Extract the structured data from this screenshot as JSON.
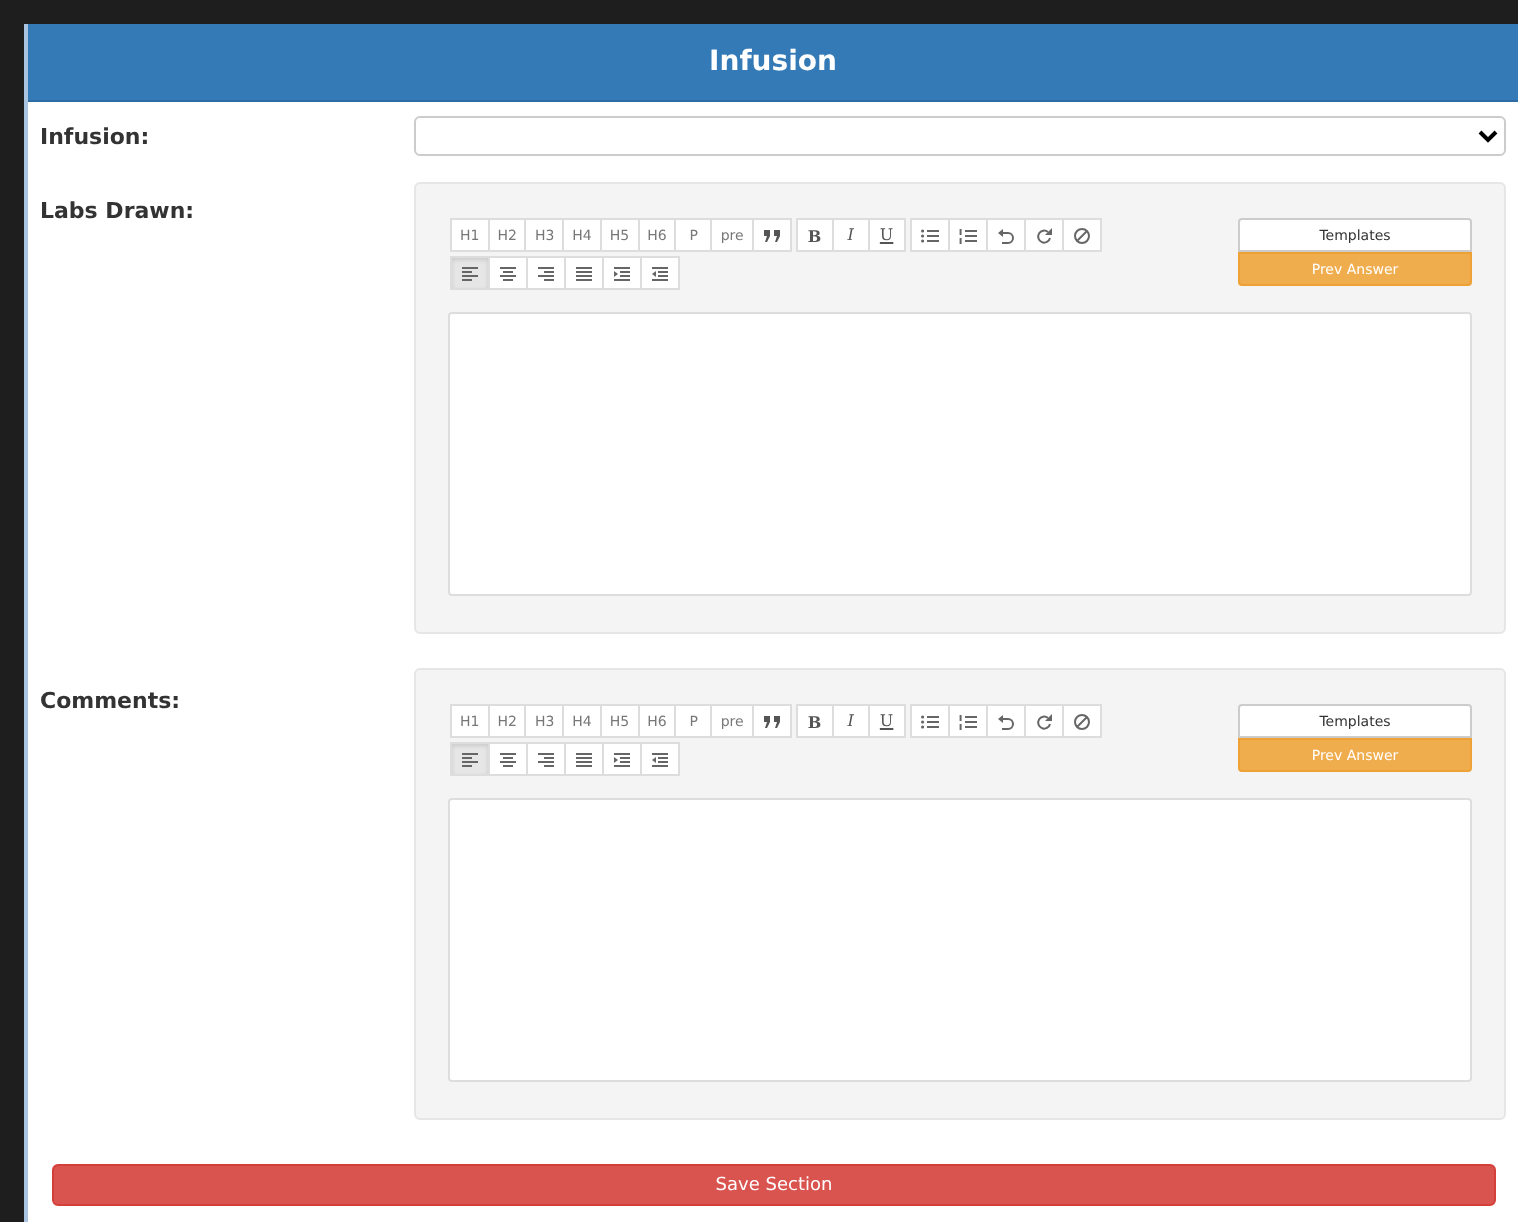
{
  "header": {
    "title": "Infusion"
  },
  "infusion": {
    "label": "Infusion:"
  },
  "editors": [
    {
      "label": "Labs Drawn:",
      "headings": [
        "H1",
        "H2",
        "H3",
        "H4",
        "H5",
        "H6",
        "P",
        "pre"
      ],
      "formats": [
        "B",
        "I",
        "U"
      ],
      "align": [
        {
          "selected": true
        },
        {
          "selected": false
        },
        {
          "selected": false
        },
        {
          "selected": false
        },
        {
          "selected": false
        },
        {
          "selected": false
        }
      ],
      "templates": "Templates",
      "prev_answer": "Prev Answer"
    },
    {
      "label": "Comments:",
      "headings": [
        "H1",
        "H2",
        "H3",
        "H4",
        "H5",
        "H6",
        "P",
        "pre"
      ],
      "formats": [
        "B",
        "I",
        "U"
      ],
      "align": [
        {
          "selected": true
        },
        {
          "selected": false
        },
        {
          "selected": false
        },
        {
          "selected": false
        },
        {
          "selected": false
        },
        {
          "selected": false
        }
      ],
      "templates": "Templates",
      "prev_answer": "Prev Answer"
    }
  ],
  "save_button": "Save Section"
}
